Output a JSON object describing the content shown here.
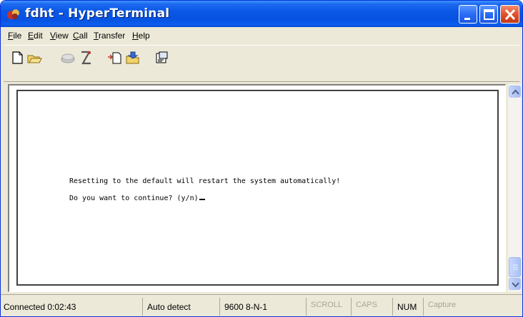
{
  "window": {
    "title": "fdht - HyperTerminal",
    "icon": "hyperterminal-icon"
  },
  "menu": {
    "items": [
      {
        "label": "File",
        "accel": "F"
      },
      {
        "label": "Edit",
        "accel": "E"
      },
      {
        "label": "View",
        "accel": "V"
      },
      {
        "label": "Call",
        "accel": "C"
      },
      {
        "label": "Transfer",
        "accel": "T"
      },
      {
        "label": "Help",
        "accel": "H"
      }
    ]
  },
  "toolbar": {
    "buttons": [
      "new-icon",
      "open-icon",
      "disconnect-icon",
      "dial-icon",
      "send-icon",
      "receive-icon",
      "properties-icon"
    ]
  },
  "terminal": {
    "lines": [
      "Resetting to the default will restart the system automatically!",
      "Do you want to continue? (y/n)"
    ]
  },
  "status": {
    "connected": "Connected 0:02:43",
    "detect": "Auto detect",
    "port": "9600 8-N-1",
    "scroll": "SCROLL",
    "caps": "CAPS",
    "num": "NUM",
    "capture": "Capture"
  }
}
